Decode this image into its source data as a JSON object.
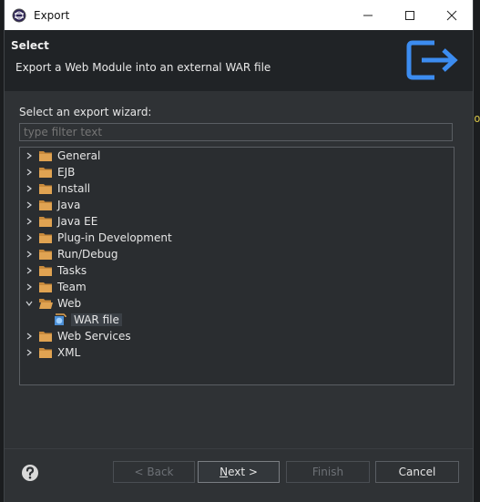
{
  "window": {
    "title": "Export"
  },
  "header": {
    "title": "Select",
    "description": "Export a Web Module into an external WAR file"
  },
  "wizard": {
    "label": "Select an export wizard:",
    "filter_placeholder": "type filter text"
  },
  "tree": {
    "items": [
      {
        "label": "General",
        "expanded": false
      },
      {
        "label": "EJB",
        "expanded": false
      },
      {
        "label": "Install",
        "expanded": false
      },
      {
        "label": "Java",
        "expanded": false
      },
      {
        "label": "Java EE",
        "expanded": false
      },
      {
        "label": "Plug-in Development",
        "expanded": false
      },
      {
        "label": "Run/Debug",
        "expanded": false
      },
      {
        "label": "Tasks",
        "expanded": false
      },
      {
        "label": "Team",
        "expanded": false
      },
      {
        "label": "Web",
        "expanded": true
      },
      {
        "label": "WAR file",
        "child": true,
        "selected": true
      },
      {
        "label": "Web Services",
        "expanded": false
      },
      {
        "label": "XML",
        "expanded": false
      }
    ]
  },
  "buttons": {
    "back": "< Back",
    "next_prefix": "",
    "next_mnemonic": "N",
    "next_rest": "ext >",
    "finish": "Finish",
    "cancel": "Cancel"
  },
  "background": {
    "fragments": [
      "Do"
    ]
  },
  "colors": {
    "accent_blue": "#3c8cf0",
    "folder": "#c88a3c",
    "dialog_bg": "#2f3235"
  }
}
